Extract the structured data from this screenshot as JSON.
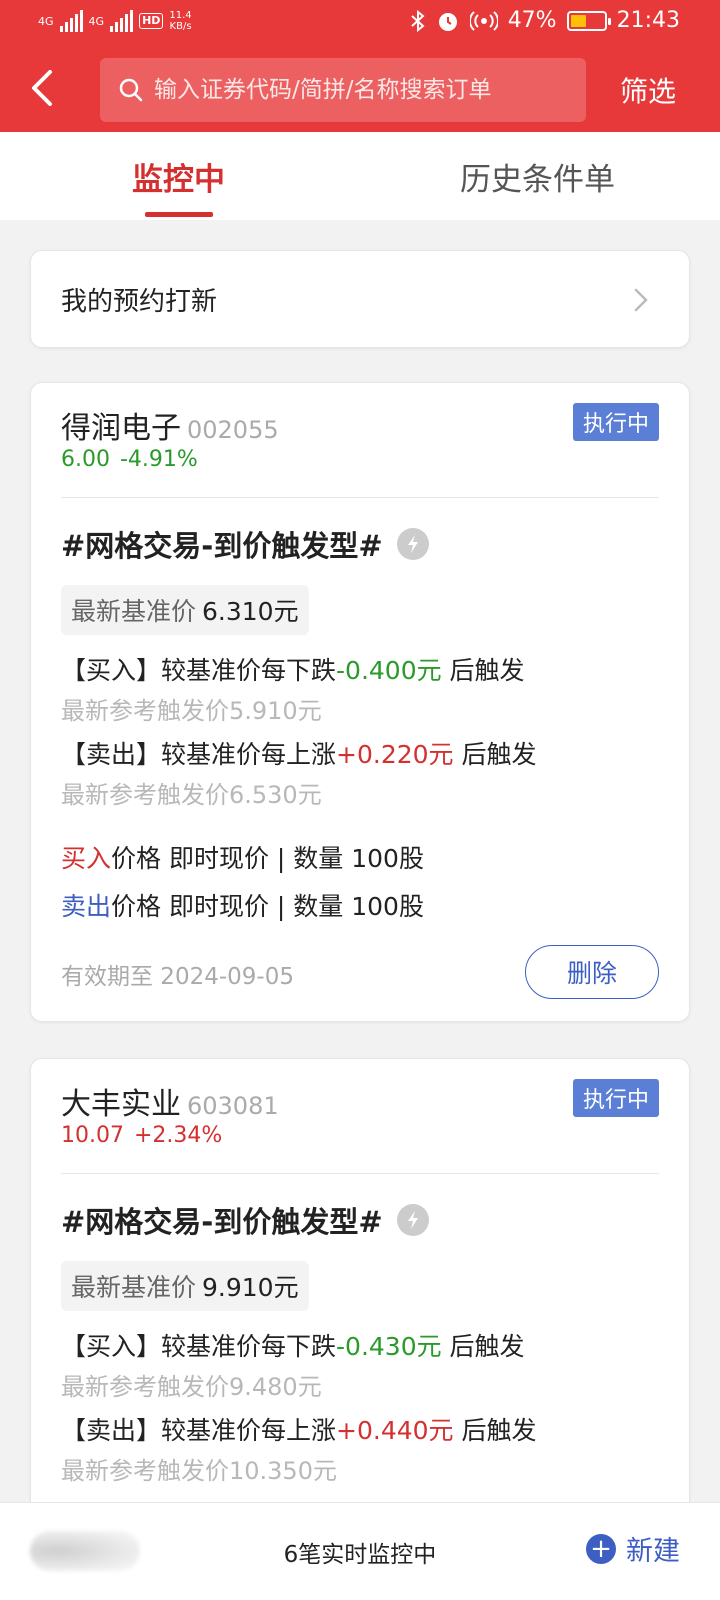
{
  "status_bar": {
    "network1": "4G",
    "network2": "4G",
    "hd": "HD",
    "speed": "11.4",
    "speed_unit": "KB/s",
    "battery_level": 0.47,
    "battery": "47%",
    "time": "21:43"
  },
  "header": {
    "search_placeholder": "输入证券代码/简拼/名称搜索订单",
    "filter_label": "筛选"
  },
  "tabs": [
    {
      "label": "监控中",
      "active": true
    },
    {
      "label": "历史条件单",
      "active": false
    }
  ],
  "ipo_entry": {
    "label": "我的预约打新"
  },
  "orders": [
    {
      "name": "得润电子",
      "code": "002055",
      "status": "执行中",
      "price": "6.00",
      "change": "-4.91%",
      "strategy": "#网格交易-到价触发型#",
      "base_label": "最新基准价",
      "base_value": "6.310元",
      "buy_rule_prefix": "【买入】较基准价每下跌",
      "buy_rule_value": "-0.400元",
      "buy_rule_suffix": " 后触发",
      "buy_ref": "最新参考触发价5.910元",
      "sell_rule_prefix": "【卖出】较基准价每上涨",
      "sell_rule_value": "+0.220元",
      "sell_rule_suffix": " 后触发",
      "sell_ref": "最新参考触发价6.530元",
      "buy_label": "买入",
      "buy_detail": "价格 即时现价 | 数量 100股",
      "sell_label": "卖出",
      "sell_detail": "价格 即时现价 | 数量 100股",
      "expiry": "有效期至 2024-09-05",
      "delete_label": "删除"
    },
    {
      "name": "大丰实业",
      "code": "603081",
      "status": "执行中",
      "price": "10.07",
      "change": "+2.34%",
      "strategy": "#网格交易-到价触发型#",
      "base_label": "最新基准价",
      "base_value": "9.910元",
      "buy_rule_prefix": "【买入】较基准价每下跌",
      "buy_rule_value": "-0.430元",
      "buy_rule_suffix": " 后触发",
      "buy_ref": "最新参考触发价9.480元",
      "sell_rule_prefix": "【卖出】较基准价每上涨",
      "sell_rule_value": "+0.440元",
      "sell_rule_suffix": " 后触发",
      "sell_ref": "最新参考触发价10.350元"
    }
  ],
  "bottom": {
    "monitor_text": "6笔实时监控中",
    "new_label": "新建"
  },
  "colors": {
    "brand_red": "#e8393a",
    "down_green": "#2a9a2a",
    "up_red": "#d3302f",
    "action_blue": "#3d5fc4",
    "badge_blue": "#5b7fd6"
  }
}
